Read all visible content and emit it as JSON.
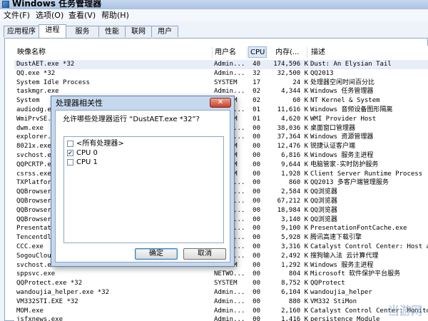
{
  "window": {
    "title": "Windows 任务管理器"
  },
  "menu": [
    {
      "label": "文件(F)"
    },
    {
      "label": "选项(O)"
    },
    {
      "label": "查看(V)"
    },
    {
      "label": "帮助(H)"
    }
  ],
  "tabs": [
    {
      "label": "应用程序"
    },
    {
      "label": "进程"
    },
    {
      "label": "服务"
    },
    {
      "label": "性能"
    },
    {
      "label": "联网"
    },
    {
      "label": "用户"
    }
  ],
  "active_tab": "进程",
  "columns": {
    "name": "映像名称",
    "user": "用户名",
    "cpu": "CPU",
    "mem": "内存(...",
    "desc": "描述"
  },
  "processes": [
    {
      "name": "DustAET.exe *32",
      "user": "Admin...",
      "cpu": "40",
      "mem": "174,596 K",
      "desc": "Dust: An Elysian Tail"
    },
    {
      "name": "QQ.exe *32",
      "user": "Admin...",
      "cpu": "32",
      "mem": "32,500 K",
      "desc": "QQ2013"
    },
    {
      "name": "System Idle Process",
      "user": "SYSTEM",
      "cpu": "17",
      "mem": "24 K",
      "desc": "处理器空闲时间百分比"
    },
    {
      "name": "taskmgr.exe",
      "user": "Admin...",
      "cpu": "02",
      "mem": "4,344 K",
      "desc": "Windows 任务管理器"
    },
    {
      "name": "System",
      "user": "SYSTEM",
      "cpu": "02",
      "mem": "60 K",
      "desc": "NT Kernel & System"
    },
    {
      "name": "audiodg.exe",
      "user": "LOCAL...",
      "cpu": "01",
      "mem": "11,616 K",
      "desc": "Windows 音频设备图形隔离"
    },
    {
      "name": "WmiPrvSE.exe",
      "user": "SYSTEM",
      "cpu": "01",
      "mem": "4,620 K",
      "desc": "WMI Provider Host"
    },
    {
      "name": "dwm.exe",
      "user": "Admin...",
      "cpu": "00",
      "mem": "38,036 K",
      "desc": "桌面窗口管理器"
    },
    {
      "name": "explorer.exe",
      "user": "Admin...",
      "cpu": "00",
      "mem": "37,364 K",
      "desc": "Windows 资源管理器"
    },
    {
      "name": "8021x.exe",
      "user": "SYSTEM",
      "cpu": "00",
      "mem": "12,476 K",
      "desc": "锐捷认证客户端"
    },
    {
      "name": "svchost.exe",
      "user": "SYSTEM",
      "cpu": "00",
      "mem": "6,816 K",
      "desc": "Windows 服务主进程"
    },
    {
      "name": "QQPCRTP.exe",
      "user": "SYSTEM",
      "cpu": "00",
      "mem": "9,644 K",
      "desc": "电脑管家-实时防护服务"
    },
    {
      "name": "csrss.exe",
      "user": "SYSTEM",
      "cpu": "00",
      "mem": "1,928 K",
      "desc": "Client Server Runtime Process"
    },
    {
      "name": "TXPlatform.exe *32",
      "user": "Admin...",
      "cpu": "00",
      "mem": "860 K",
      "desc": "QQ2013 多客户端管理服务"
    },
    {
      "name": "QQBrowser.exe *32",
      "user": "Admin...",
      "cpu": "00",
      "mem": "2,584 K",
      "desc": "QQ浏览器"
    },
    {
      "name": "QQBrowser.exe *32",
      "user": "Admin...",
      "cpu": "00",
      "mem": "67,212 K",
      "desc": "QQ浏览器"
    },
    {
      "name": "QQBrowser.exe *32",
      "user": "Admin...",
      "cpu": "00",
      "mem": "18,984 K",
      "desc": "QQ浏览器"
    },
    {
      "name": "QQBrowser.exe *32",
      "user": "Admin...",
      "cpu": "00",
      "mem": "3,140 K",
      "desc": "QQ浏览器"
    },
    {
      "name": "PresentationFontCache.exe",
      "user": "LOCAL...",
      "cpu": "00",
      "mem": "9,100 K",
      "desc": "PresentationFontCache.exe"
    },
    {
      "name": "Tencentdl.exe *32",
      "user": "Admin...",
      "cpu": "00",
      "mem": "5,928 K",
      "desc": "腾讯高速下载引擎"
    },
    {
      "name": "CCC.exe",
      "user": "Admin...",
      "cpu": "00",
      "mem": "3,316 K",
      "desc": "Catalyst Control Center: Host appli"
    },
    {
      "name": "SogouCloud.exe *32",
      "user": "Admin...",
      "cpu": "00",
      "mem": "2,492 K",
      "desc": "搜狗输入法 云计算代理"
    },
    {
      "name": "svchost.exe",
      "user": "SYSTEM",
      "cpu": "00",
      "mem": "1,292 K",
      "desc": "Windows 服务主进程"
    },
    {
      "name": "sppsvc.exe",
      "user": "NETWO...",
      "cpu": "00",
      "mem": "804 K",
      "desc": "Microsoft 软件保护平台服务"
    },
    {
      "name": "QQProtect.exe *32",
      "user": "SYSTEM",
      "cpu": "00",
      "mem": "8,752 K",
      "desc": "QQProtect"
    },
    {
      "name": "wandoujia_helper.exe *32",
      "user": "Admin...",
      "cpu": "00",
      "mem": "6,104 K",
      "desc": "wandoujia_helper"
    },
    {
      "name": "VM332STI.EXE *32",
      "user": "Admin...",
      "cpu": "00",
      "mem": "880 K",
      "desc": "VM332 StiMon"
    },
    {
      "name": "MOM.exe",
      "user": "Admin...",
      "cpu": "00",
      "mem": "2,160 K",
      "desc": "Catalyst Control Center: Monitoring"
    },
    {
      "name": "jsfxnews.exe",
      "user": "Admin...",
      "cpu": "00",
      "mem": "1,416 K",
      "desc": "persistence Module"
    }
  ],
  "dialog": {
    "title": "处理器相关性",
    "close_glyph": "✕",
    "question": "允许哪些处理器运行 “DustAET.exe *32”?",
    "options": [
      {
        "label": "<所有处理器>",
        "checked": false
      },
      {
        "label": "CPU 0",
        "checked": true
      },
      {
        "label": "CPU 1",
        "checked": false
      }
    ],
    "ok_label": "确定",
    "cancel_label": "取消"
  },
  "watermark": "当游网",
  "colors": {
    "accent": "#3c7fb1",
    "selection": "#dbe8f8"
  }
}
